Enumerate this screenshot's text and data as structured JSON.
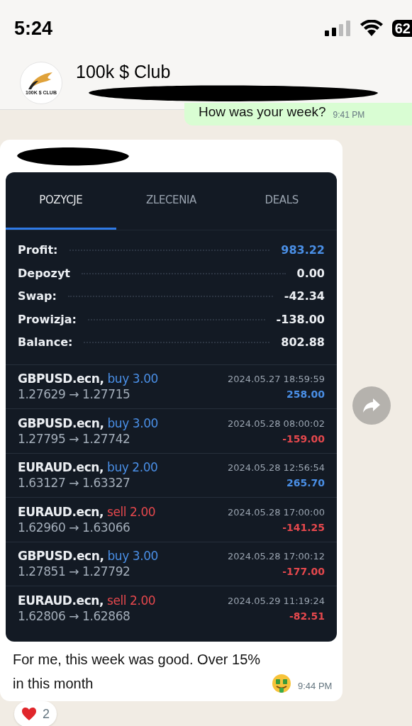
{
  "status_bar": {
    "time": "5:24",
    "battery": "62"
  },
  "chat_header": {
    "title": "100k $ Club",
    "avatar_text": "100K $ CLUB"
  },
  "messages": [
    {
      "kind": "outgoing",
      "text": "How was your week?",
      "time": "9:41 PM"
    },
    {
      "kind": "incoming",
      "text": "For me, this week was good. Over 15% in this month",
      "time": "9:44 PM",
      "reaction_count": "2"
    }
  ],
  "trading_screenshot": {
    "tabs": [
      {
        "label": "POZYCJE",
        "selected": true
      },
      {
        "label": "ZLECENIA",
        "selected": false
      },
      {
        "label": "DEALS",
        "selected": false
      }
    ],
    "summary": [
      {
        "label": "Profit:",
        "value": "983.22",
        "highlight": true
      },
      {
        "label": "Depozyt",
        "value": "0.00",
        "highlight": false
      },
      {
        "label": "Swap:",
        "value": "-42.34",
        "highlight": false
      },
      {
        "label": "Prowizja:",
        "value": "-138.00",
        "highlight": false
      },
      {
        "label": "Balance:",
        "value": "802.88",
        "highlight": false
      }
    ],
    "trades": [
      {
        "symbol": "GBPUSD.ecn,",
        "kind": "buy",
        "volume": "buy 3.00",
        "prices": "1.27629 → 1.27715",
        "time": "2024.05.27 18:59:59",
        "profit": "258.00",
        "color": "#4a8fe6"
      },
      {
        "symbol": "GBPUSD.ecn,",
        "kind": "buy",
        "volume": "buy 3.00",
        "prices": "1.27795 → 1.27742",
        "time": "2024.05.28 08:00:02",
        "profit": "-159.00",
        "color": "#e5484d"
      },
      {
        "symbol": "EURAUD.ecn,",
        "kind": "buy",
        "volume": "buy 2.00",
        "prices": "1.63127 → 1.63327",
        "time": "2024.05.28 12:56:54",
        "profit": "265.70",
        "color": "#4a8fe6"
      },
      {
        "symbol": "EURAUD.ecn,",
        "kind": "sell",
        "volume": "sell 2.00",
        "prices": "1.62960 → 1.63066",
        "time": "2024.05.28 17:00:00",
        "profit": "-141.25",
        "color": "#e5484d"
      },
      {
        "symbol": "GBPUSD.ecn,",
        "kind": "buy",
        "volume": "buy 3.00",
        "prices": "1.27851 → 1.27792",
        "time": "2024.05.28 17:00:12",
        "profit": "-177.00",
        "color": "#e5484d"
      },
      {
        "symbol": "EURAUD.ecn,",
        "kind": "sell",
        "volume": "sell 2.00",
        "prices": "1.62806 → 1.62868",
        "time": "2024.05.29 11:19:24",
        "profit": "-82.51",
        "color": "#e5484d"
      }
    ]
  }
}
